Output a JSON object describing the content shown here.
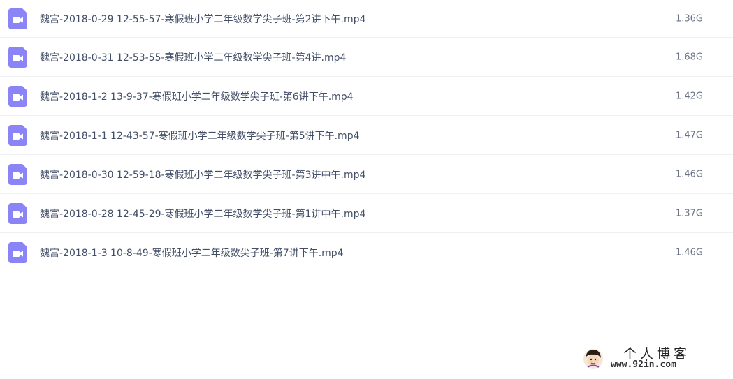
{
  "files": [
    {
      "name": "魏宫-2018-0-29 12-55-57-寒假班小学二年级数学尖子班-第2讲下午.mp4",
      "size": "1.36G",
      "icon": "video-file-icon"
    },
    {
      "name": "魏宫-2018-0-31 12-53-55-寒假班小学二年级数学尖子班-第4讲.mp4",
      "size": "1.68G",
      "icon": "video-file-icon"
    },
    {
      "name": "魏宫-2018-1-2 13-9-37-寒假班小学二年级数学尖子班-第6讲下午.mp4",
      "size": "1.42G",
      "icon": "video-file-icon"
    },
    {
      "name": "魏宫-2018-1-1 12-43-57-寒假班小学二年级数学尖子班-第5讲下午.mp4",
      "size": "1.47G",
      "icon": "video-file-icon"
    },
    {
      "name": "魏宫-2018-0-30 12-59-18-寒假班小学二年级数学尖子班-第3讲中午.mp4",
      "size": "1.46G",
      "icon": "video-file-icon"
    },
    {
      "name": "魏宫-2018-0-28 12-45-29-寒假班小学二年级数学尖子班-第1讲中午.mp4",
      "size": "1.37G",
      "icon": "video-file-icon"
    },
    {
      "name": "魏宫-2018-1-3 10-8-49-寒假班小学二年级数尖子班-第7讲下午.mp4",
      "size": "1.46G",
      "icon": "video-file-icon"
    }
  ],
  "watermark": {
    "title": "个人博客",
    "url": "www.92in.com"
  },
  "colors": {
    "icon_purple": "#8a84f7",
    "text": "#424e67",
    "size_text": "#6a7386",
    "divider": "#eef0f4"
  }
}
